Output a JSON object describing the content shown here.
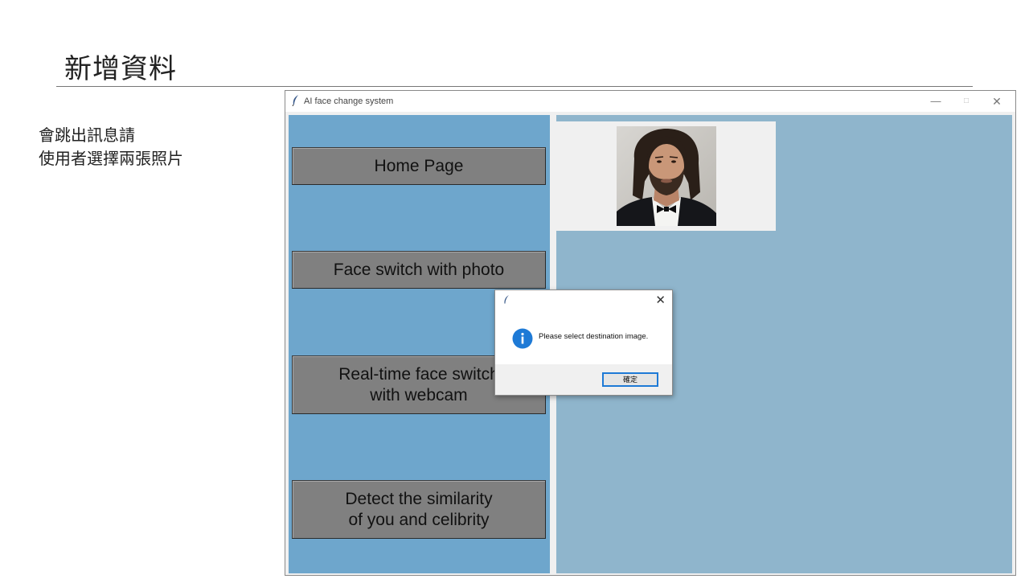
{
  "slide": {
    "title": "新增資料",
    "note_line1": "會跳出訊息請",
    "note_line2": "使用者選擇兩張照片"
  },
  "window": {
    "title": "AI face change system",
    "controls": {
      "minimize": "—",
      "maximize": "□",
      "close": "✕"
    }
  },
  "sidebar": {
    "buttons": [
      {
        "label": "Home Page"
      },
      {
        "label": "Face switch with photo"
      },
      {
        "label": "Real-time face switch\nwith webcam"
      },
      {
        "label": "Detect the similarity\nof you and celibrity"
      }
    ]
  },
  "dialog": {
    "message": "Please select destination image.",
    "ok_label": "確定",
    "close": "✕"
  },
  "colors": {
    "sidebar_bg": "#6ea6cc",
    "content_bg": "#8fb5cc",
    "button_bg": "#808080",
    "info_blue": "#1e7ad6"
  }
}
